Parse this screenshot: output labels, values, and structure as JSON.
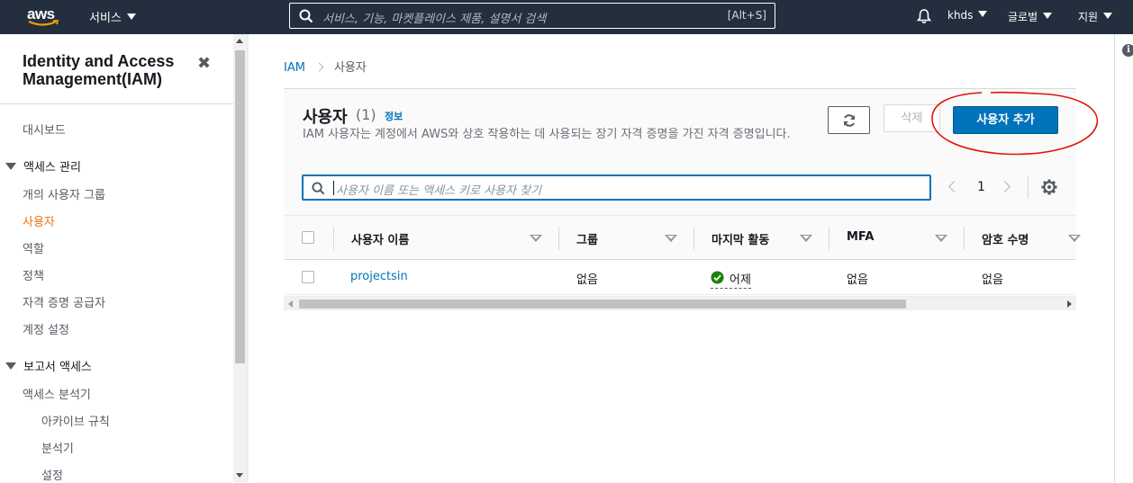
{
  "topbar": {
    "logo_text": "aws",
    "services_label": "서비스",
    "search_placeholder": "서비스, 기능, 마켓플레이스 제품, 설명서 검색",
    "search_shortcut": "[Alt+S]",
    "account_label": "khds",
    "region_label": "글로벌",
    "support_label": "지원"
  },
  "sidebar": {
    "title": "Identity and Access Management(IAM)",
    "items": [
      {
        "label": "대시보드",
        "type": "link"
      },
      {
        "label": "액세스 관리",
        "type": "section"
      },
      {
        "label": "개의 사용자 그룹",
        "type": "link"
      },
      {
        "label": "사용자",
        "type": "link",
        "active": true
      },
      {
        "label": "역할",
        "type": "link"
      },
      {
        "label": "정책",
        "type": "link"
      },
      {
        "label": "자격 증명 공급자",
        "type": "link"
      },
      {
        "label": "계정 설정",
        "type": "link"
      },
      {
        "label": "보고서 액세스",
        "type": "section"
      },
      {
        "label": "액세스 분석기",
        "type": "link"
      },
      {
        "label": "아카이브 규칙",
        "type": "sublink"
      },
      {
        "label": "분석기",
        "type": "sublink"
      },
      {
        "label": "설정",
        "type": "sublink"
      }
    ]
  },
  "breadcrumb": {
    "root": "IAM",
    "current": "사용자"
  },
  "panel": {
    "title": "사용자",
    "count": "(1)",
    "info_link": "정보",
    "description": "IAM 사용자는 계정에서 AWS와 상호 작용하는 데 사용되는 장기 자격 증명을 가진 자격 증명입니다.",
    "delete_label": "삭제",
    "add_user_label": "사용자 추가",
    "filter_placeholder": "사용자 이름 또는 액세스 키로 사용자 찾기",
    "page_number": "1"
  },
  "table": {
    "columns": [
      "사용자 이름",
      "그룹",
      "마지막 활동",
      "MFA",
      "암호 수명"
    ],
    "rows": [
      {
        "username": "projectsin",
        "groups": "없음",
        "last_activity": "어제",
        "mfa": "없음",
        "password_age": "없음"
      }
    ]
  },
  "colors": {
    "topbar_bg": "#232f3e",
    "accent_orange": "#ec7211",
    "link_blue": "#0073bb",
    "primary_button": "#0073bb",
    "success_green": "#1d8102",
    "annotation_red": "#e3120b"
  }
}
